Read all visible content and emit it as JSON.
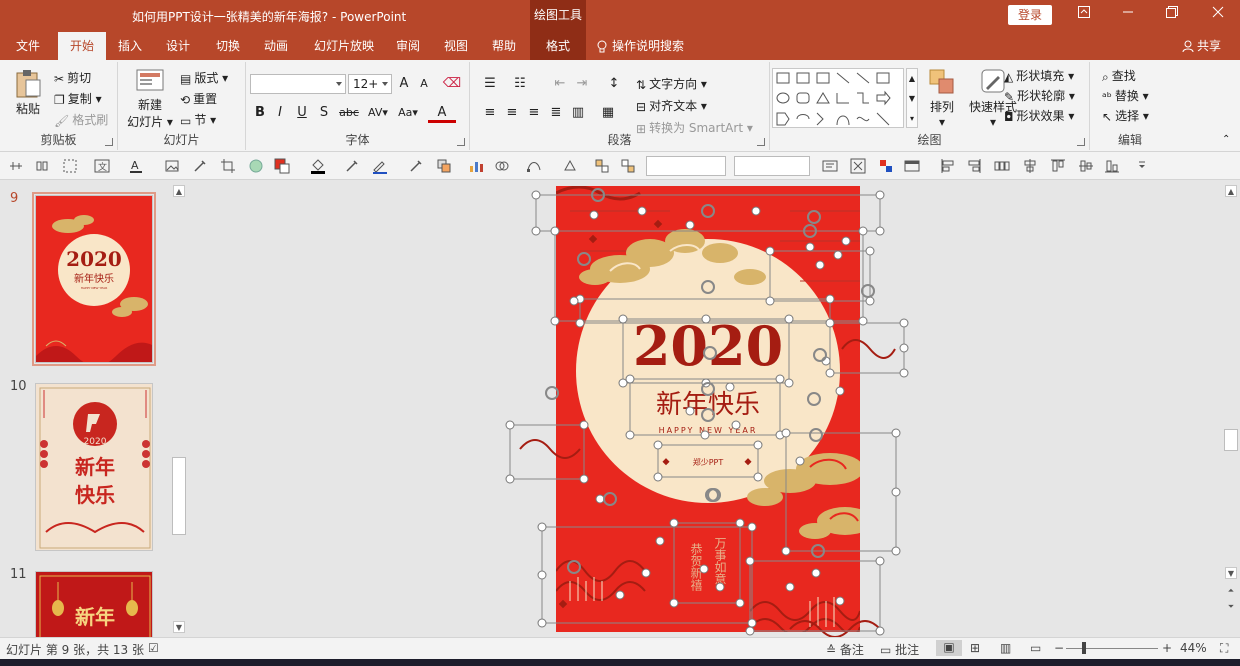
{
  "titlebar": {
    "doc_title": "如何用PPT设计一张精美的新年海报?  -  PowerPoint",
    "context_title": "绘图工具",
    "login_label": "登录",
    "accent_color": "#b7472a",
    "context_color": "#8f2d16"
  },
  "tabs": [
    {
      "label": "文件"
    },
    {
      "label": "开始",
      "active": true
    },
    {
      "label": "插入"
    },
    {
      "label": "设计"
    },
    {
      "label": "切换"
    },
    {
      "label": "动画"
    },
    {
      "label": "幻灯片放映"
    },
    {
      "label": "审阅"
    },
    {
      "label": "视图"
    },
    {
      "label": "帮助"
    },
    {
      "label": "格式"
    }
  ],
  "tellme": "操作说明搜索",
  "share": "共享",
  "ribbon": {
    "clipboard": {
      "paste": "粘贴",
      "cut": "剪切",
      "copy": "复制",
      "format_painter": "格式刷",
      "label": "剪贴板"
    },
    "slides": {
      "new_slide": "新建",
      "new_slide_2": "幻灯片",
      "layout": "版式",
      "reset": "重置",
      "section": "节",
      "label": "幻灯片"
    },
    "font": {
      "font_name": "",
      "font_size": "12+",
      "grow": "A",
      "shrink": "A",
      "bold": "B",
      "italic": "I",
      "underline": "U",
      "shadow": "S",
      "strike": "abc",
      "spacing": "AV",
      "case": "Aa",
      "color": "A",
      "label": "字体"
    },
    "paragraph": {
      "text_direction": "文字方向",
      "align_text": "对齐文本",
      "smartart": "转换为 SmartArt",
      "label": "段落"
    },
    "drawing": {
      "arrange": "排列",
      "quick_styles": "快速样式",
      "shape_fill": "形状填充",
      "shape_outline": "形状轮廓",
      "shape_effects": "形状效果",
      "label": "绘图"
    },
    "editing": {
      "find": "查找",
      "replace": "替换",
      "select": "选择",
      "label": "编辑"
    }
  },
  "thumbnails": [
    {
      "number": "9",
      "selected": true
    },
    {
      "number": "10",
      "selected": false
    },
    {
      "number": "11",
      "selected": false
    }
  ],
  "poster": {
    "year": "2020",
    "greeting": "新年快乐",
    "subtitle": "HAPPY NEW YEAR",
    "author": "郑少PPT",
    "vertical_left": "恭贺新禧",
    "vertical_right": "万事如意",
    "bg_color": "#e8281f",
    "moon_color": "#f9e6c8",
    "gold_color": "#d8b46a"
  },
  "thumb10": {
    "year": "2020",
    "greeting_1": "新年",
    "greeting_2": "快乐"
  },
  "thumb11": {
    "greeting": "新年"
  },
  "status": {
    "slide_info": "幻灯片 第 9 张，共 13 张",
    "notes": "备注",
    "comments": "批注",
    "zoom": "44%"
  }
}
